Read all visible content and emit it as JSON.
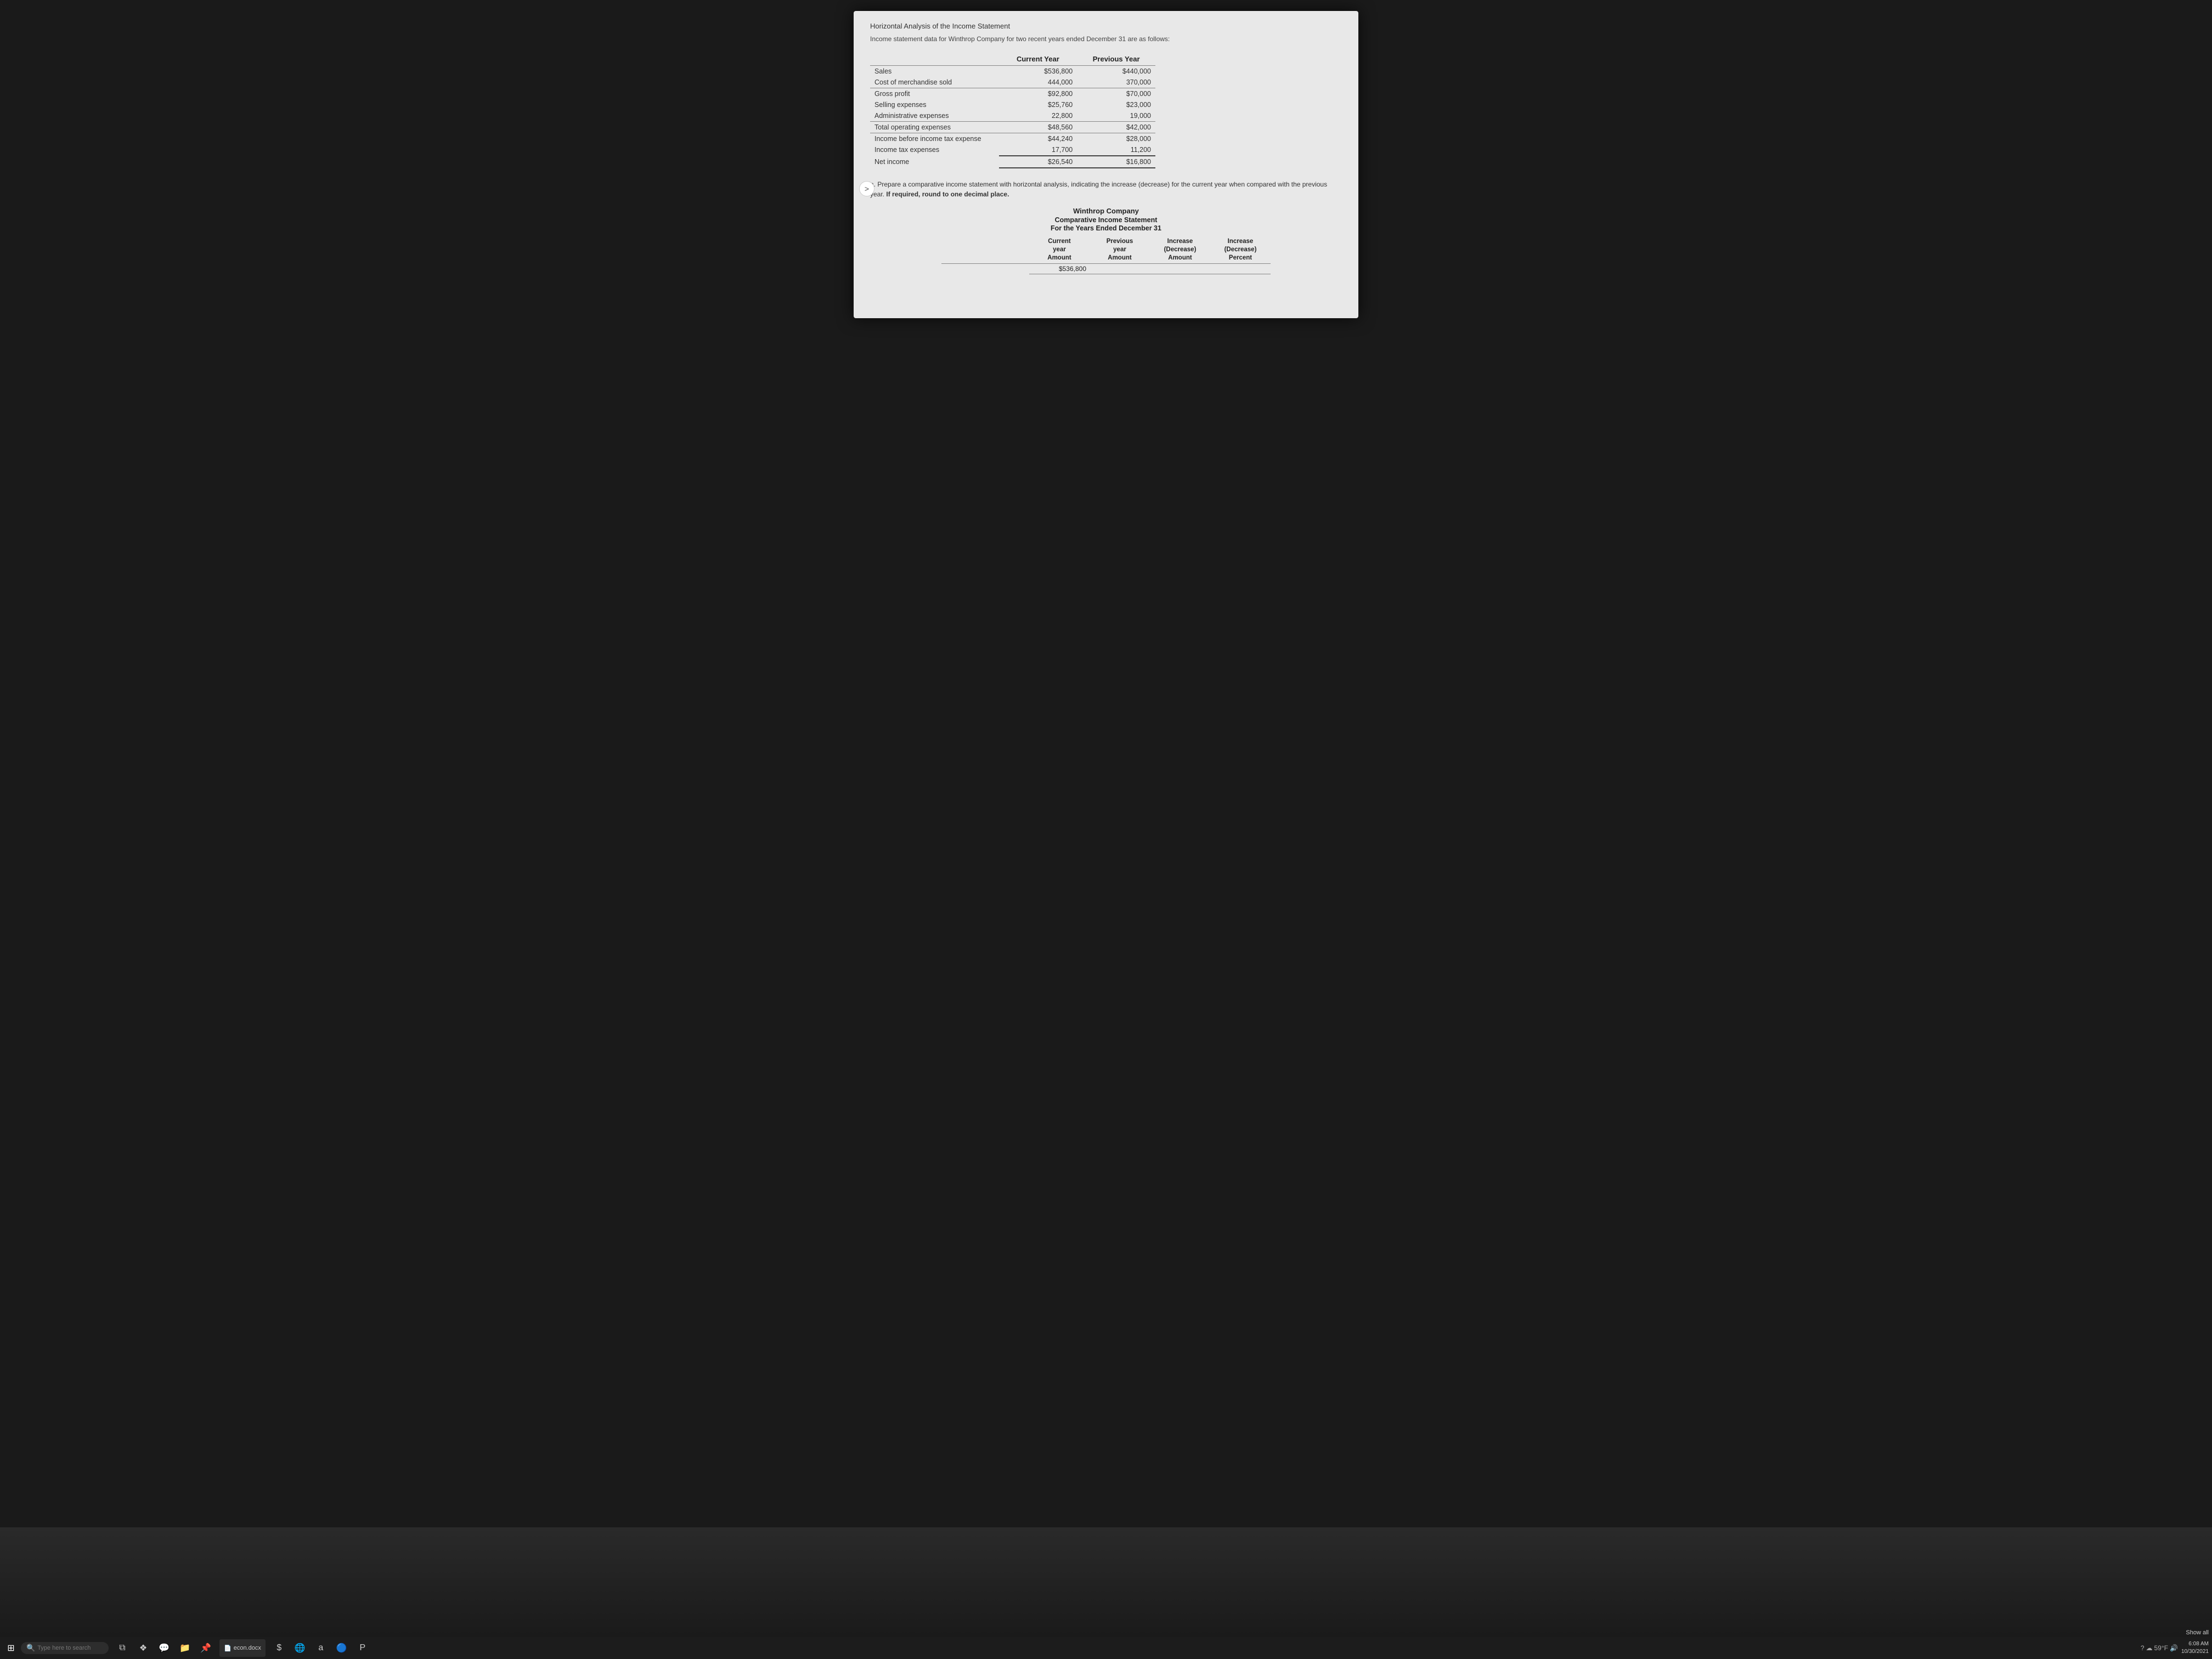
{
  "page": {
    "title": "Horizontal Analysis of the Income Statement",
    "subtitle": "Income statement data for Winthrop Company for two recent years ended December 31 are as follows:"
  },
  "income_table": {
    "col1_header": "Current Year",
    "col2_header": "Previous Year",
    "rows": [
      {
        "label": "Sales",
        "current": "$536,800",
        "previous": "$440,000",
        "border": "top"
      },
      {
        "label": "Cost of merchandise sold",
        "current": "444,000",
        "previous": "370,000",
        "border": ""
      },
      {
        "label": "Gross profit",
        "current": "$92,800",
        "previous": "$70,000",
        "border": "top"
      },
      {
        "label": "Selling expenses",
        "current": "$25,760",
        "previous": "$23,000",
        "border": ""
      },
      {
        "label": "Administrative expenses",
        "current": "22,800",
        "previous": "19,000",
        "border": ""
      },
      {
        "label": "Total operating expenses",
        "current": "$48,560",
        "previous": "$42,000",
        "border": "top"
      },
      {
        "label": "Income before income tax expense",
        "current": "$44,240",
        "previous": "$28,000",
        "border": "top"
      },
      {
        "label": "Income tax expenses",
        "current": "17,700",
        "previous": "11,200",
        "border": ""
      },
      {
        "label": "Net income",
        "current": "$26,540",
        "previous": "$16,800",
        "border": "double"
      }
    ]
  },
  "instruction": {
    "letter": "a.",
    "text": "Prepare a comparative income statement with horizontal analysis, indicating the increase (decrease) for the current year when compared with the previous year.",
    "bold_text": "If required, round to one decimal place."
  },
  "comparative": {
    "company": "Winthrop Company",
    "statement": "Comparative Income Statement",
    "period": "For the Years Ended December 31",
    "col_headers": {
      "col1": "Current year Amount",
      "col2": "Previous year Amount",
      "col3": "Increase (Decrease) Amount",
      "col4": "Increase (Decrease) Percent"
    }
  },
  "taskbar": {
    "search_placeholder": "Type here to search",
    "open_doc": "econ.docx",
    "show_all": "Show all",
    "time": "6:08 AM",
    "date": "10/30/2021",
    "weather": "59°F"
  }
}
